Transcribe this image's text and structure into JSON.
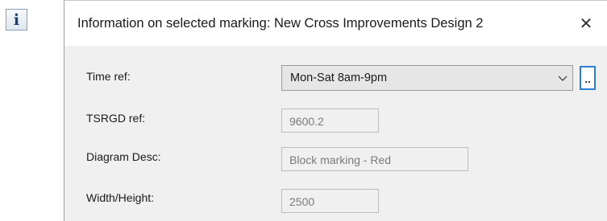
{
  "info_badge": {
    "glyph": "i",
    "icon": "info-icon"
  },
  "dialog": {
    "title": "Information on selected marking: New Cross Improvements Design 2",
    "close_glyph": "✕"
  },
  "fields": {
    "time_ref": {
      "label": "Time ref:",
      "value": "Mon-Sat 8am-9pm",
      "browse_label": ".."
    },
    "tsrgd_ref": {
      "label": "TSRGD ref:",
      "value": "9600.2"
    },
    "diagram_desc": {
      "label": "Diagram Desc:",
      "value": "Block marking - Red"
    },
    "width_height": {
      "label": "Width/Height:",
      "value": "2500"
    }
  },
  "colors": {
    "accent": "#2a7fd4",
    "dialog_bg": "#f0f0f0",
    "disabled_text": "#7a7a7a"
  }
}
